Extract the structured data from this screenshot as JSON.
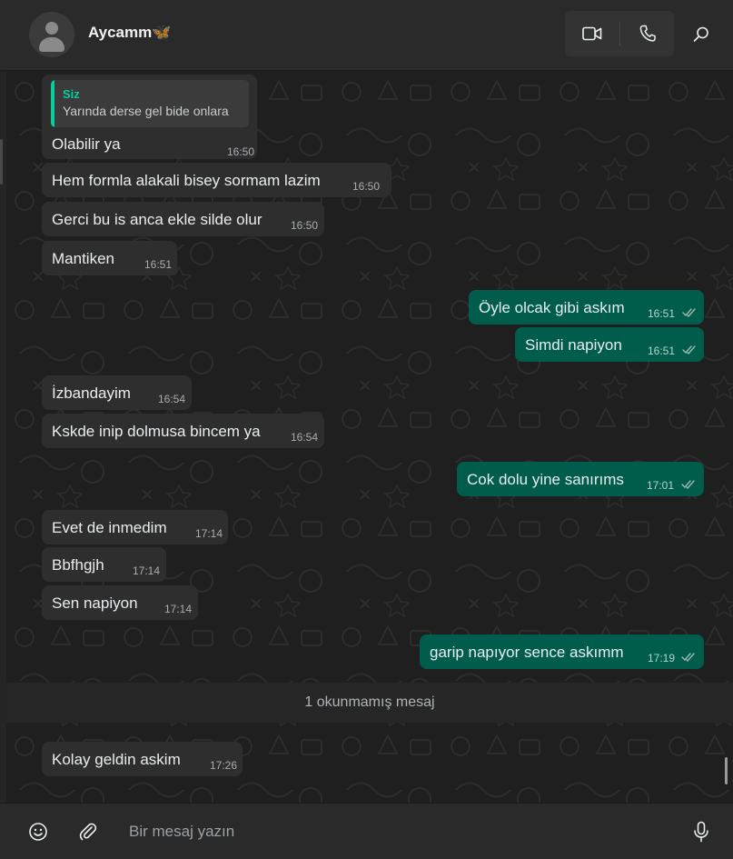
{
  "header": {
    "contact_name": "Aycamm🦋",
    "icons": {
      "avatar": "person-placeholder",
      "video": "video-camera-icon",
      "voice": "phone-icon",
      "search": "search-icon"
    }
  },
  "quote": {
    "author": "Siz",
    "text": "Yarında derse gel bide onlara"
  },
  "messages": [
    {
      "dir": "in",
      "text": "Olabilir ya",
      "time": "16:50"
    },
    {
      "dir": "in",
      "text": "Hem formla alakali bisey sormam lazim",
      "time": "16:50"
    },
    {
      "dir": "in",
      "text": "Gerci bu is anca ekle silde olur",
      "time": "16:50"
    },
    {
      "dir": "in",
      "text": "Mantiken",
      "time": "16:51"
    },
    {
      "dir": "out",
      "text": "Öyle olcak gibi askım",
      "time": "16:51"
    },
    {
      "dir": "out",
      "text": "Simdi napiyon",
      "time": "16:51"
    },
    {
      "dir": "in",
      "text": "İzbandayim",
      "time": "16:54"
    },
    {
      "dir": "in",
      "text": "Kskde inip dolmusa bincem ya",
      "time": "16:54"
    },
    {
      "dir": "out",
      "text": "Cok dolu yine sanırıms",
      "time": "17:01"
    },
    {
      "dir": "in",
      "text": "Evet de inmedim",
      "time": "17:14"
    },
    {
      "dir": "in",
      "text": "Bbfhgjh",
      "time": "17:14"
    },
    {
      "dir": "in",
      "text": "Sen napiyon",
      "time": "17:14"
    },
    {
      "dir": "out",
      "text": "garip napıyor sence askımm",
      "time": "17:19"
    },
    {
      "dir": "in",
      "text": "Kolay geldin askim",
      "time": "17:26"
    }
  ],
  "unread_banner": "1 okunmamış mesaj",
  "composer": {
    "placeholder": "Bir mesaj yazın",
    "icons": {
      "emoji": "emoji-icon",
      "attach": "paperclip-icon",
      "mic": "microphone-icon"
    }
  },
  "colors": {
    "incoming_bubble": "#2e2e2e",
    "outgoing_bubble": "#005c4b",
    "accent": "#06cf9c",
    "background": "#1f1f1f"
  }
}
